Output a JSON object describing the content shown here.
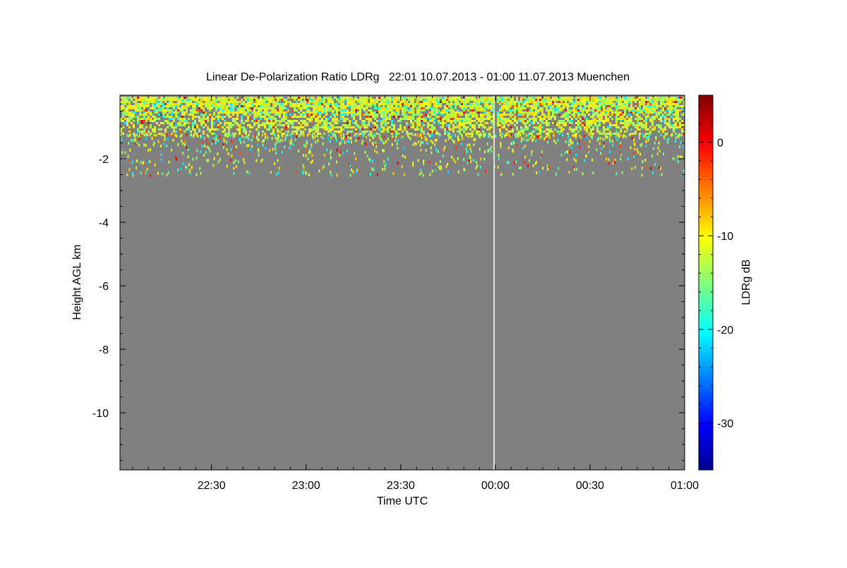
{
  "chart_data": {
    "type": "heatmap",
    "title": "Linear De-Polarization Ratio LDRg   22:01 10.07.2013 - 01:00 11.07.2013 Muenchen",
    "xlabel": "Time UTC",
    "ylabel": "Height AGL km",
    "xlim": [
      "22:01",
      "01:00"
    ],
    "ylim": [
      -11.8,
      0
    ],
    "x_ticks": [
      "22:30",
      "23:00",
      "23:30",
      "00:00",
      "00:30",
      "01:00"
    ],
    "y_ticks": [
      "-2",
      "-4",
      "-6",
      "-8",
      "-10"
    ],
    "background_value_color": "#808080",
    "signal_layer": {
      "height_km": [
        -1.6,
        -0.2
      ],
      "typical_ldr_db": [
        -15,
        -8
      ]
    },
    "data_gap_time": "00:00",
    "colorbar": {
      "label": "LDRg dB",
      "range": [
        -35,
        5
      ],
      "ticks": [
        "0",
        "-10",
        "-20",
        "-30"
      ],
      "colormap": [
        "#00008f",
        "#0000ff",
        "#00ffff",
        "#ffff00",
        "#ff0000",
        "#800000"
      ]
    }
  }
}
